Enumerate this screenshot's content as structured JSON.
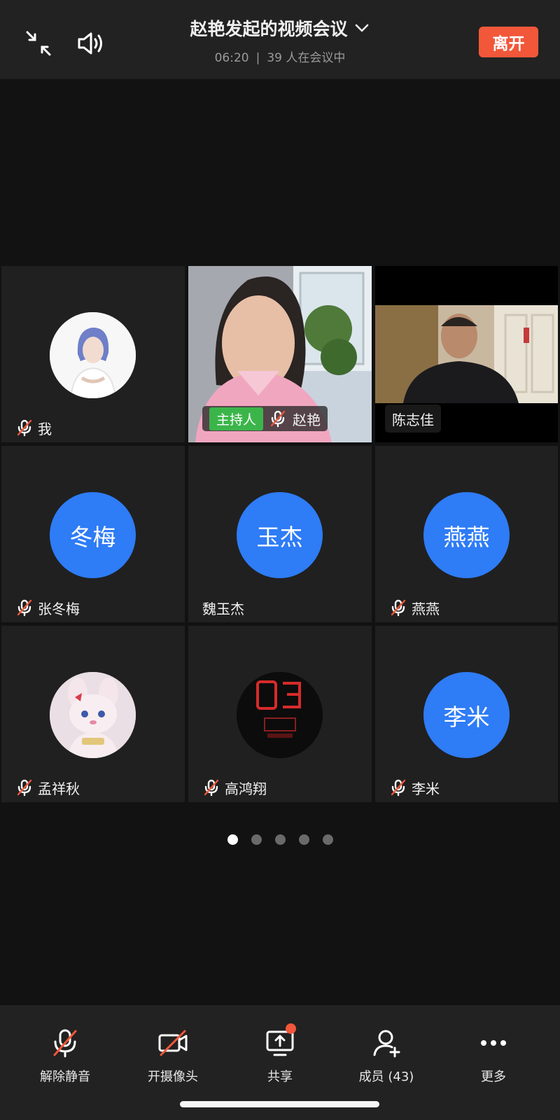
{
  "header": {
    "title": "赵艳发起的视频会议",
    "elapsed": "06:20",
    "participants_status": "39 人在会议中",
    "leave_label": "离开"
  },
  "participants": [
    {
      "id": "me",
      "name": "我",
      "muted": true,
      "avatar_type": "photo",
      "avatar_icon": "woman-portrait-avatar"
    },
    {
      "id": "zhaoyan",
      "name": "赵艳",
      "muted": true,
      "video": true,
      "host": true,
      "host_label": "主持人"
    },
    {
      "id": "chenzhijia",
      "name": "陈志佳",
      "muted": false,
      "video": true
    },
    {
      "id": "zhangdongmei",
      "name": "张冬梅",
      "muted": true,
      "avatar_text": "冬梅"
    },
    {
      "id": "weiyujie",
      "name": "魏玉杰",
      "muted": false,
      "avatar_text": "玉杰"
    },
    {
      "id": "yanyan",
      "name": "燕燕",
      "muted": true,
      "avatar_text": "燕燕"
    },
    {
      "id": "mengxiangqiu",
      "name": "孟祥秋",
      "muted": true,
      "avatar_type": "photo",
      "avatar_icon": "plush-toy-avatar"
    },
    {
      "id": "gaohongxiang",
      "name": "高鸿翔",
      "muted": true,
      "avatar_type": "photo",
      "avatar_icon": "neon-03-avatar"
    },
    {
      "id": "limi",
      "name": "李米",
      "muted": true,
      "avatar_text": "李米"
    }
  ],
  "pagination": {
    "total": 5,
    "current": 1
  },
  "toolbar": {
    "unmute": "解除静音",
    "camera": "开摄像头",
    "share": "共享",
    "members": "成员 (43)",
    "more": "更多"
  },
  "colors": {
    "accent_orange": "#f2573a",
    "avatar_blue": "#2e7cf6",
    "host_green": "#3bb54a"
  }
}
